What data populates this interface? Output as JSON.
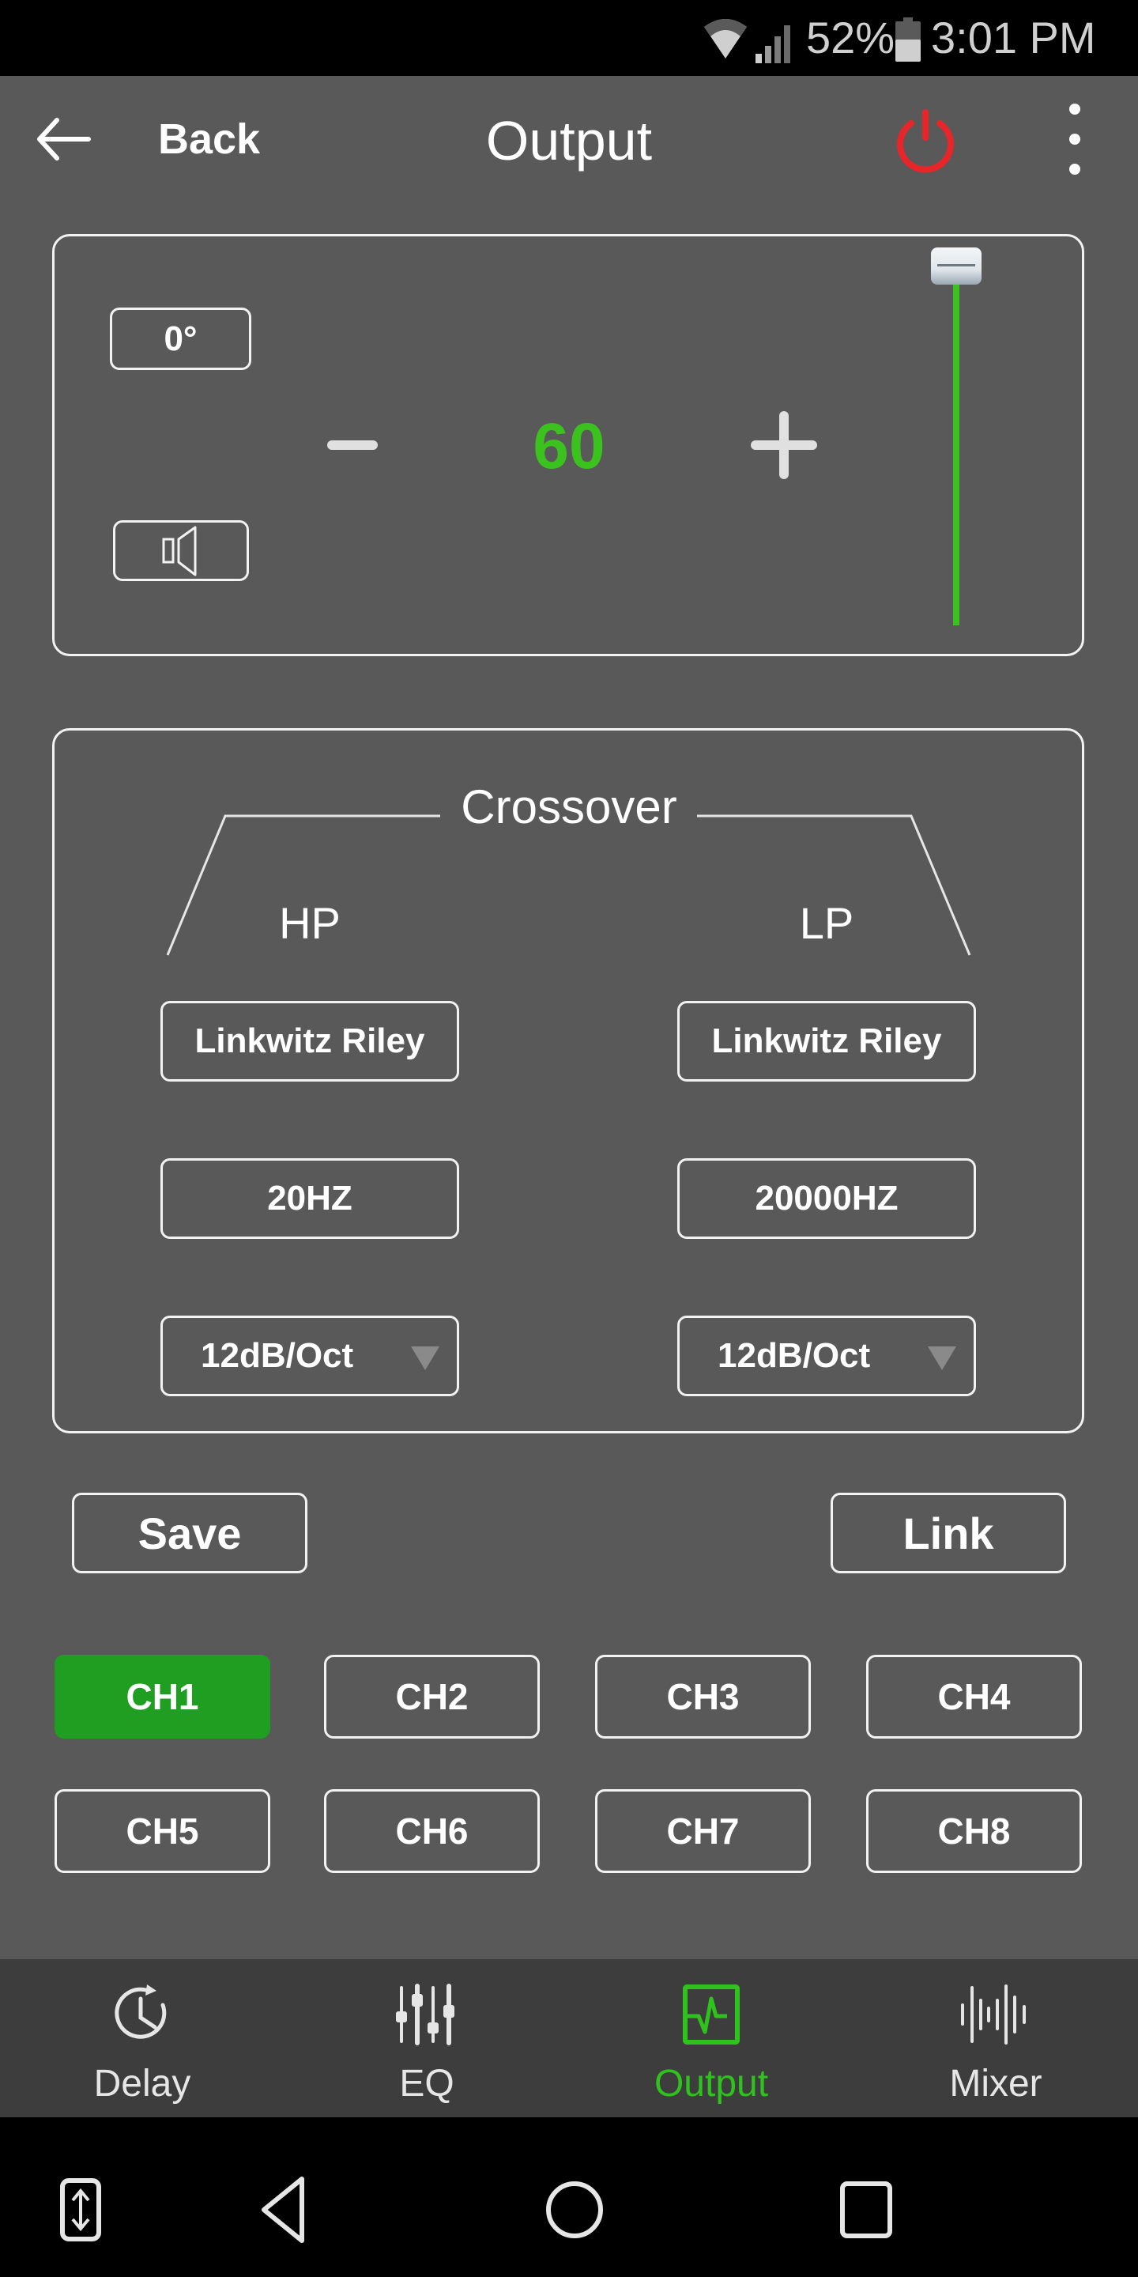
{
  "status_bar": {
    "wifi_icon": "wifi-icon",
    "signal_icon": "cell-signal-icon",
    "battery_percent": "52%",
    "battery_icon": "battery-icon",
    "time": "3:01 PM"
  },
  "header": {
    "back_icon": "arrow-left-icon",
    "back_label": "Back",
    "title": "Output",
    "power_icon": "power-icon",
    "power_color": "#e8262a",
    "menu_icon": "more-vertical-icon"
  },
  "level_panel": {
    "phase_label": "0°",
    "speaker_icon": "speaker-icon",
    "decrement_icon": "minus-icon",
    "increment_icon": "plus-icon",
    "value": "60",
    "value_color": "#3cc21e",
    "slider_level_fraction": 1.0
  },
  "crossover": {
    "title": "Crossover",
    "hp": {
      "label": "HP",
      "filter_type": "Linkwitz Riley",
      "frequency": "20HZ",
      "slope": "12dB/Oct"
    },
    "lp": {
      "label": "LP",
      "filter_type": "Linkwitz Riley",
      "frequency": "20000HZ",
      "slope": "12dB/Oct"
    }
  },
  "actions": {
    "save_label": "Save",
    "link_label": "Link"
  },
  "channels": {
    "selected": "CH1",
    "accent_color": "#1f9e22",
    "items": [
      {
        "label": "CH1",
        "active": true
      },
      {
        "label": "CH2",
        "active": false
      },
      {
        "label": "CH3",
        "active": false
      },
      {
        "label": "CH4",
        "active": false
      },
      {
        "label": "CH5",
        "active": false
      },
      {
        "label": "CH6",
        "active": false
      },
      {
        "label": "CH7",
        "active": false
      },
      {
        "label": "CH8",
        "active": false
      }
    ]
  },
  "tabs": [
    {
      "label": "Delay",
      "icon": "clock-icon",
      "active": false
    },
    {
      "label": "EQ",
      "icon": "equalizer-sliders-icon",
      "active": false
    },
    {
      "label": "Output",
      "icon": "pulse-monitor-icon",
      "active": true
    },
    {
      "label": "Mixer",
      "icon": "waveform-icon",
      "active": false
    }
  ],
  "nav_bar": {
    "scroll_icon": "scroll-capture-icon",
    "back_icon": "nav-back-icon",
    "home_icon": "nav-home-icon",
    "recents_icon": "nav-recents-icon"
  }
}
